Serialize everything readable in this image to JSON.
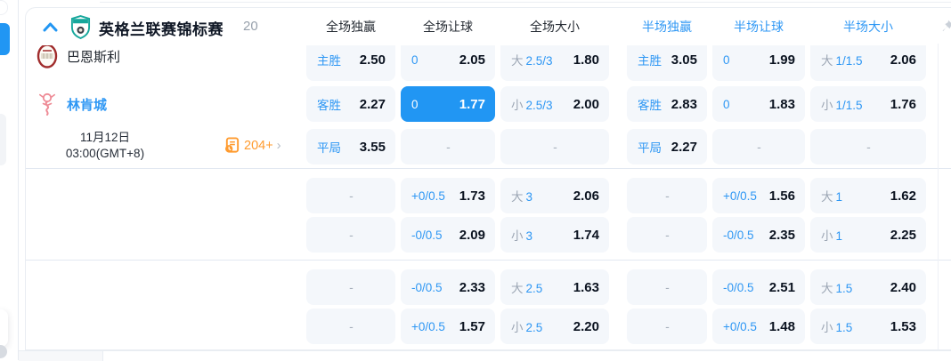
{
  "colors": {
    "accent_blue": "#2196f3",
    "label_blue": "#2e97f4",
    "orange": "#ff9b2f",
    "cell_bg": "#f4f7fb",
    "odds_dark": "#0b1320"
  },
  "dash_char": "-",
  "header": {
    "league_name": "英格兰联赛锦标赛",
    "match_count": "20",
    "columns": [
      "全场独赢",
      "全场让球",
      "全场大小",
      "半场独赢",
      "半场让球",
      "半场大小"
    ],
    "column_tones": [
      "dark",
      "dark",
      "dark",
      "blue",
      "blue",
      "blue"
    ]
  },
  "match": {
    "home_team": "巴恩斯利",
    "away_team": "林肯城",
    "date": "11月12日",
    "time": "03:00(GMT+8)",
    "more_markets": "204+"
  },
  "odds_groups": [
    {
      "rows": [
        {
          "cells": [
            {
              "label": "主胜",
              "value": "2.50"
            },
            {
              "label": "0",
              "value": "2.05"
            },
            {
              "prefix": "大",
              "line": "2.5/3",
              "value": "1.80"
            },
            {
              "label": "主胜",
              "value": "3.05"
            },
            {
              "label": "0",
              "value": "1.99"
            },
            {
              "prefix": "大",
              "line": "1/1.5",
              "value": "2.06"
            }
          ]
        },
        {
          "cells": [
            {
              "label": "客胜",
              "value": "2.27"
            },
            {
              "label": "0",
              "value": "1.77",
              "selected": true
            },
            {
              "prefix": "小",
              "line": "2.5/3",
              "value": "2.00"
            },
            {
              "label": "客胜",
              "value": "2.83"
            },
            {
              "label": "0",
              "value": "1.83"
            },
            {
              "prefix": "小",
              "line": "1/1.5",
              "value": "1.76"
            }
          ]
        },
        {
          "cells": [
            {
              "label": "平局",
              "value": "3.55"
            },
            {
              "dash": true
            },
            {
              "dash": true
            },
            {
              "label": "平局",
              "value": "2.27"
            },
            {
              "dash": true
            },
            {
              "dash": true
            }
          ]
        }
      ]
    },
    {
      "rows": [
        {
          "cells": [
            {
              "dash": true
            },
            {
              "label": "+0/0.5",
              "value": "1.73"
            },
            {
              "prefix": "大",
              "line": "3",
              "value": "2.06"
            },
            {
              "dash": true
            },
            {
              "label": "+0/0.5",
              "value": "1.56"
            },
            {
              "prefix": "大",
              "line": "1",
              "value": "1.62"
            }
          ]
        },
        {
          "cells": [
            {
              "dash": true
            },
            {
              "label": "-0/0.5",
              "value": "2.09"
            },
            {
              "prefix": "小",
              "line": "3",
              "value": "1.74"
            },
            {
              "dash": true
            },
            {
              "label": "-0/0.5",
              "value": "2.35"
            },
            {
              "prefix": "小",
              "line": "1",
              "value": "2.25"
            }
          ]
        }
      ]
    },
    {
      "rows": [
        {
          "cells": [
            {
              "dash": true
            },
            {
              "label": "-0/0.5",
              "value": "2.33"
            },
            {
              "prefix": "大",
              "line": "2.5",
              "value": "1.63"
            },
            {
              "dash": true
            },
            {
              "label": "-0/0.5",
              "value": "2.51"
            },
            {
              "prefix": "大",
              "line": "1.5",
              "value": "2.40"
            }
          ]
        },
        {
          "cells": [
            {
              "dash": true
            },
            {
              "label": "+0/0.5",
              "value": "1.57"
            },
            {
              "prefix": "小",
              "line": "2.5",
              "value": "2.20"
            },
            {
              "dash": true
            },
            {
              "label": "+0/0.5",
              "value": "1.48"
            },
            {
              "prefix": "小",
              "line": "1.5",
              "value": "1.53"
            }
          ]
        }
      ]
    }
  ]
}
